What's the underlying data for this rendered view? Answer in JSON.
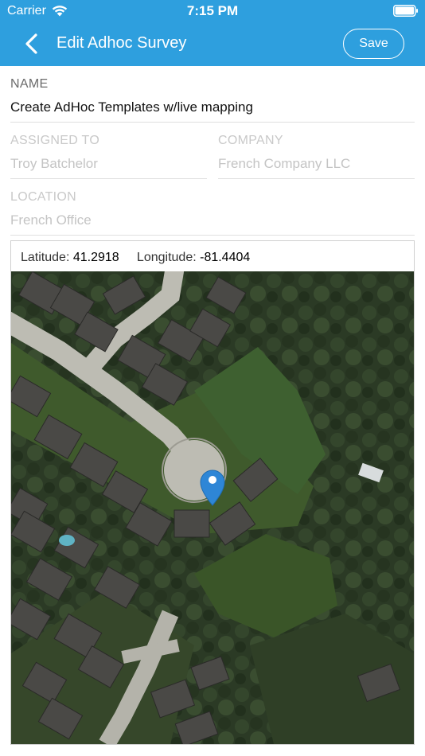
{
  "status_bar": {
    "carrier": "Carrier",
    "time": "7:15 PM",
    "wifi_icon": "wifi-icon",
    "battery_icon": "battery-icon"
  },
  "nav": {
    "back_icon": "chevron-left-icon",
    "title": "Edit Adhoc Survey",
    "save_label": "Save"
  },
  "form": {
    "name": {
      "label": "NAME",
      "value": "Create AdHoc Templates w/live mapping"
    },
    "assigned_to": {
      "label": "ASSIGNED TO",
      "value": "Troy Batchelor"
    },
    "company": {
      "label": "COMPANY",
      "value": "French Company LLC"
    },
    "location": {
      "label": "LOCATION",
      "value": "French Office"
    }
  },
  "map": {
    "latitude_label": "Latitude:",
    "latitude": "41.2918",
    "longitude_label": "Longitude:",
    "longitude": "-81.4404",
    "pin_icon": "map-pin-icon"
  },
  "colors": {
    "header": "#2e9fde",
    "pin": "#2e86d6"
  }
}
